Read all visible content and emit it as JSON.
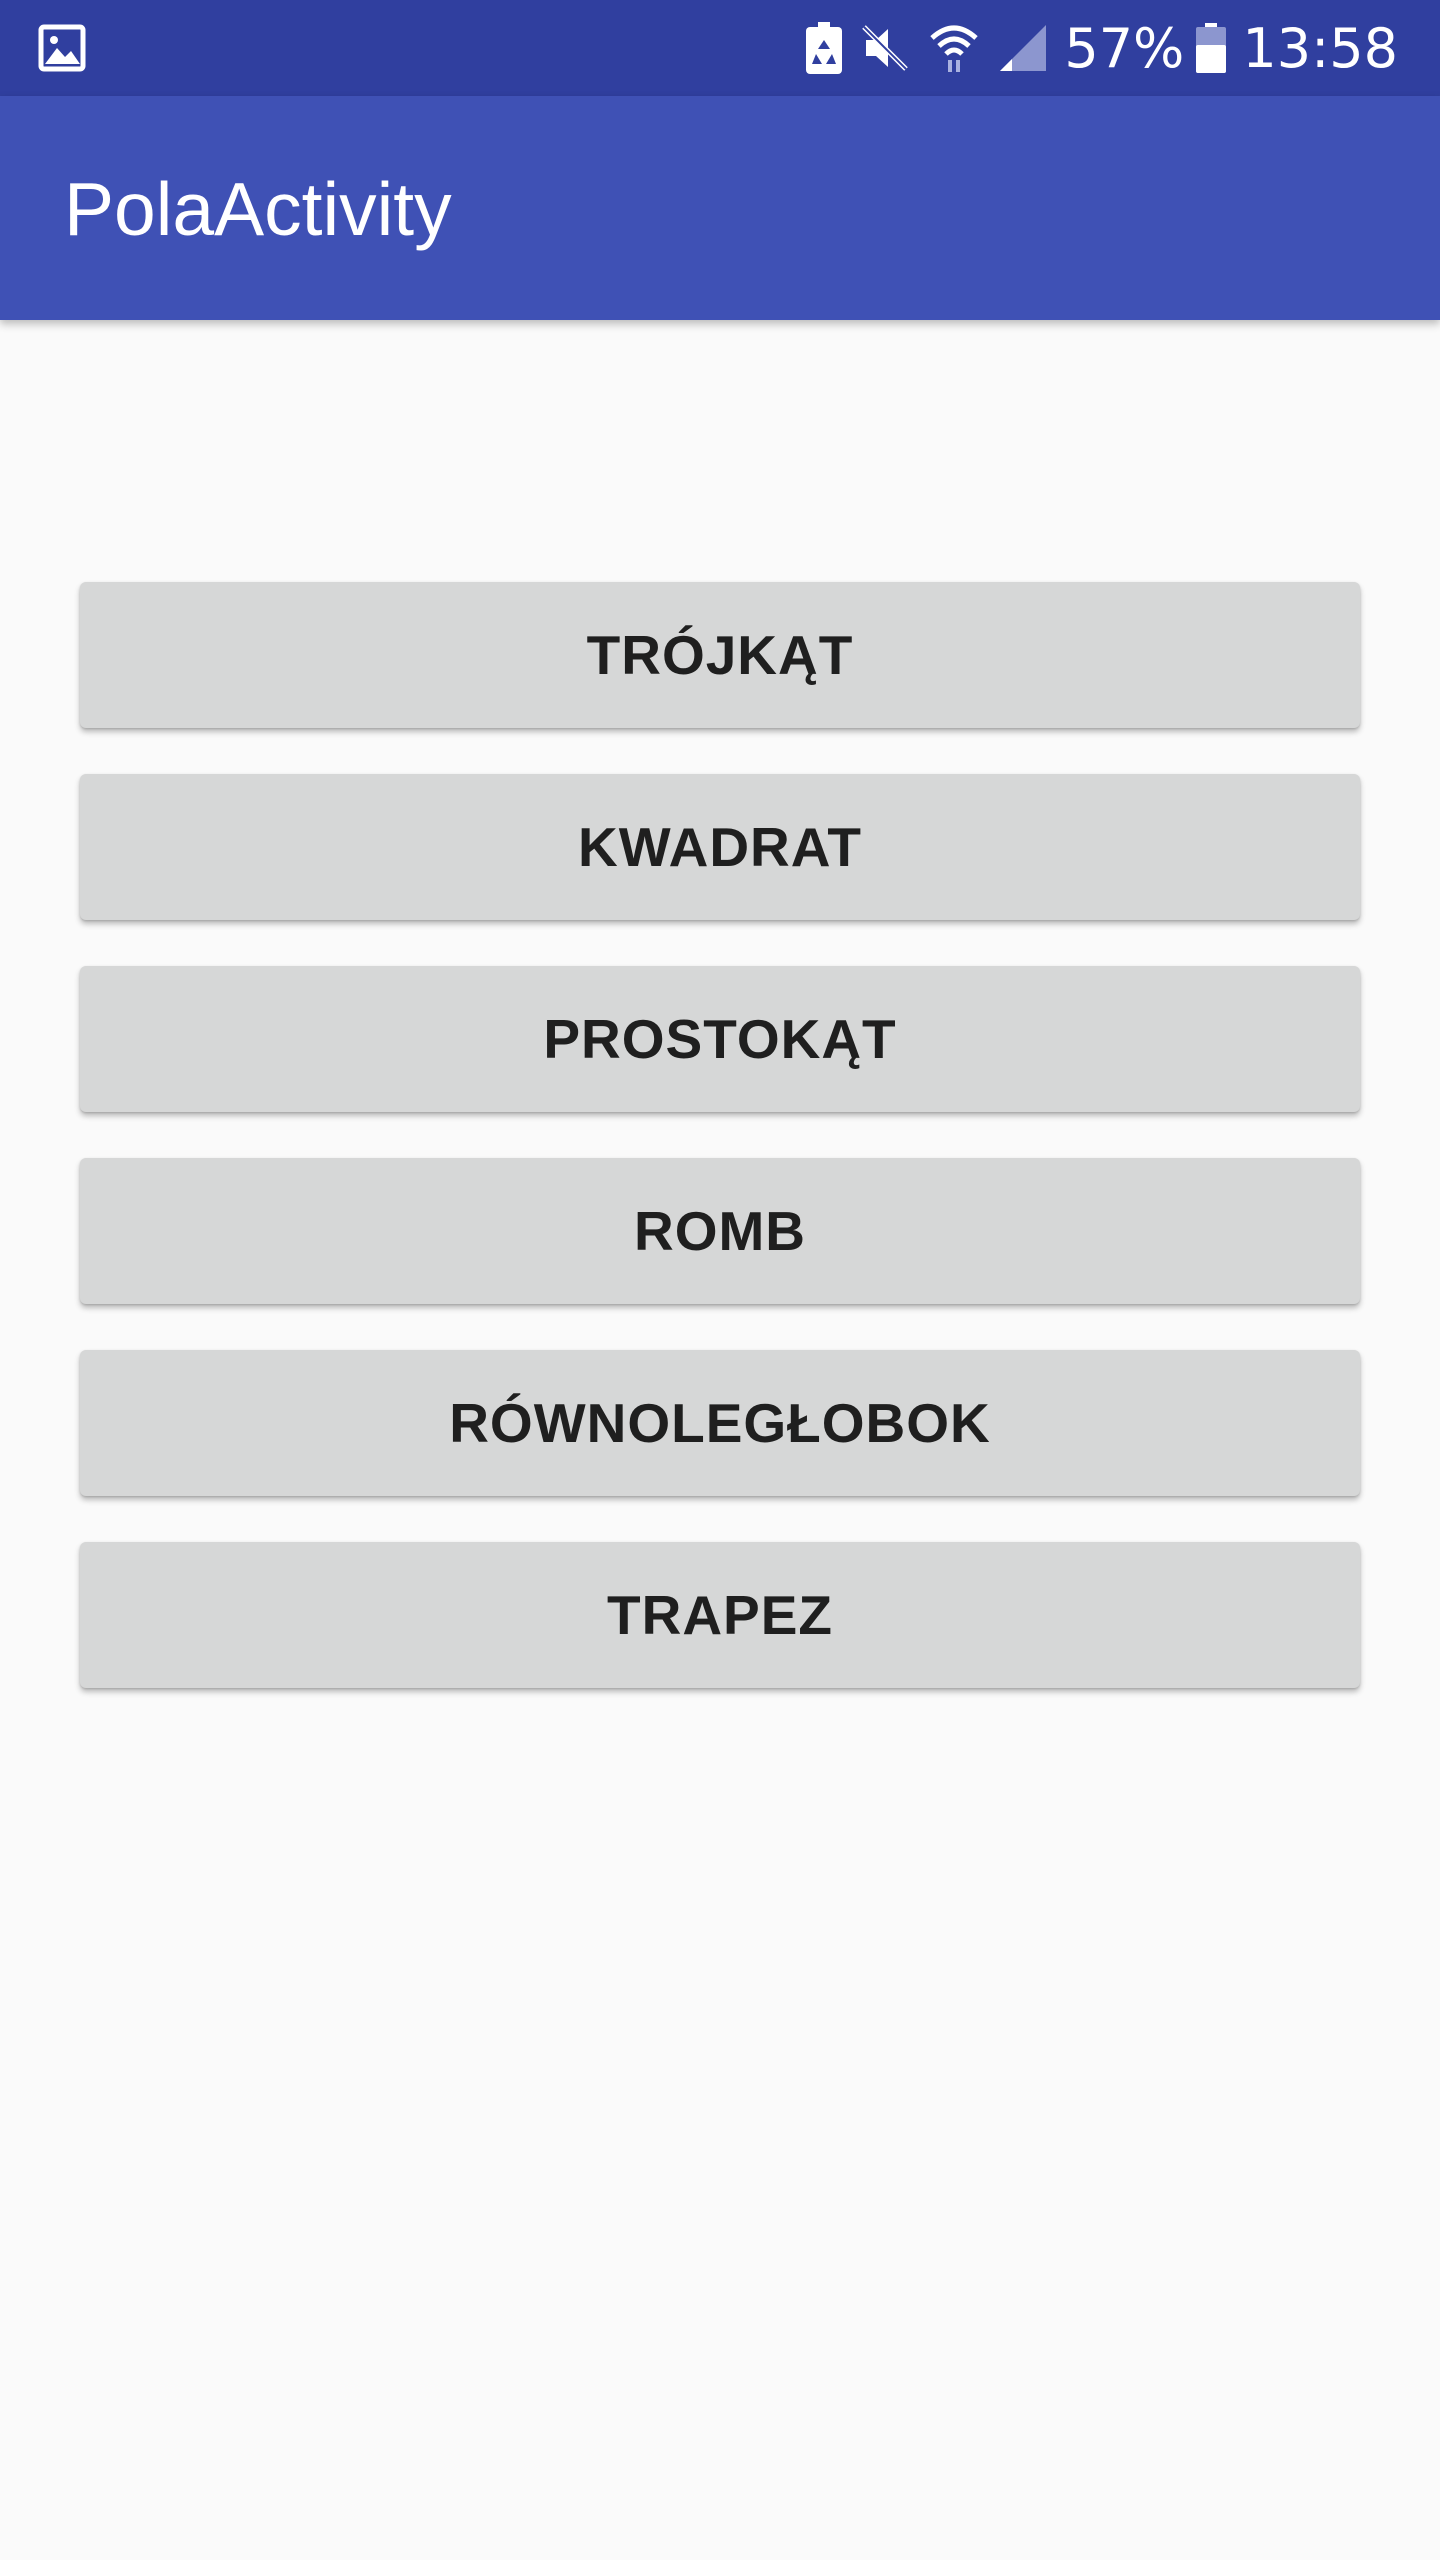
{
  "status_bar": {
    "battery_percent": "57%",
    "time": "13:58",
    "icons": [
      "image-notification-icon",
      "battery-saver-icon",
      "mute-icon",
      "wifi-icon",
      "signal-icon",
      "battery-icon"
    ]
  },
  "app_bar": {
    "title": "PolaActivity",
    "color": "#3f51b5",
    "status_color": "#303f9f"
  },
  "buttons": [
    {
      "label": "TRÓJKĄT"
    },
    {
      "label": "KWADRAT"
    },
    {
      "label": "PROSTOKĄT"
    },
    {
      "label": "ROMB"
    },
    {
      "label": "RÓWNOLEGŁOBOK"
    },
    {
      "label": "TRAPEZ"
    }
  ]
}
